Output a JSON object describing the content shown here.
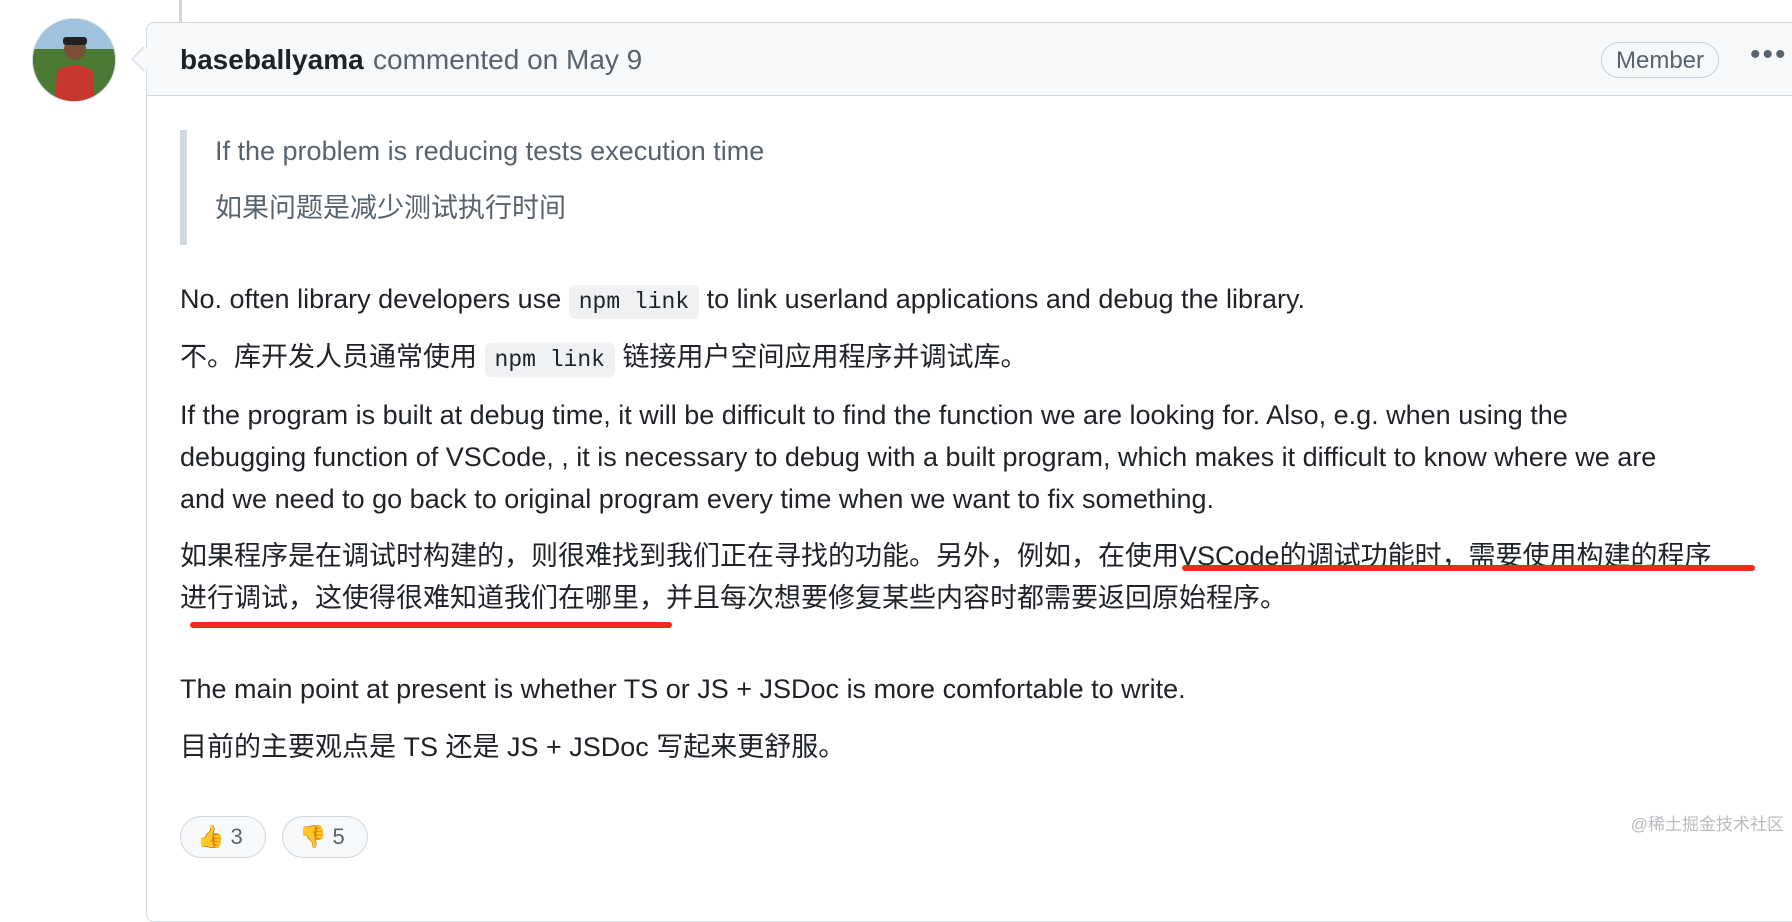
{
  "comment": {
    "author": "baseballyama",
    "action": "commented on May 9",
    "badge": "Member",
    "menu_icon": "kebab-horizontal-icon",
    "quote": {
      "line_en": "If the problem is reducing tests execution time",
      "line_zh": "如果问题是减少测试执行时间"
    },
    "para1": {
      "before": "No. often library developers use ",
      "code": "npm link",
      "after": " to link userland applications and debug the library."
    },
    "para1_zh": {
      "before": "不。库开发人员通常使用 ",
      "code": "npm link",
      "after": " 链接用户空间应用程序并调试库。"
    },
    "para2_lines": [
      "If the program is built at debug time, it will be difficult to find the function we are looking for. Also, e.g. when using the",
      "debugging function of VSCode, , it is necessary to debug with a built program, which makes it difficult to know where we are",
      "and we need to go back to original program every time when we want to fix something."
    ],
    "para2_zh_lines": [
      "如果程序是在调试时构建的，则很难找到我们正在寻找的功能。另外，例如，在使用VSCode的调试功能时，需要使用构建的程序",
      "进行调试，这使得很难知道我们在哪里，并且每次想要修复某些内容时都需要返回原始程序。"
    ],
    "para3": "The main point at present is whether TS or JS + JSDoc is more comfortable to write.",
    "para3_zh": "目前的主要观点是 TS 还是 JS + JSDoc 写起来更舒服。",
    "reactions": [
      {
        "icon": "thumbs-up-icon",
        "count": "3"
      },
      {
        "icon": "thumbs-down-icon",
        "count": "5"
      }
    ]
  },
  "watermark": "@稀土掘金技术社区",
  "colors": {
    "underline": "#ee2a1b",
    "header_bg": "#f6f8fa",
    "border": "#d0d7de"
  }
}
